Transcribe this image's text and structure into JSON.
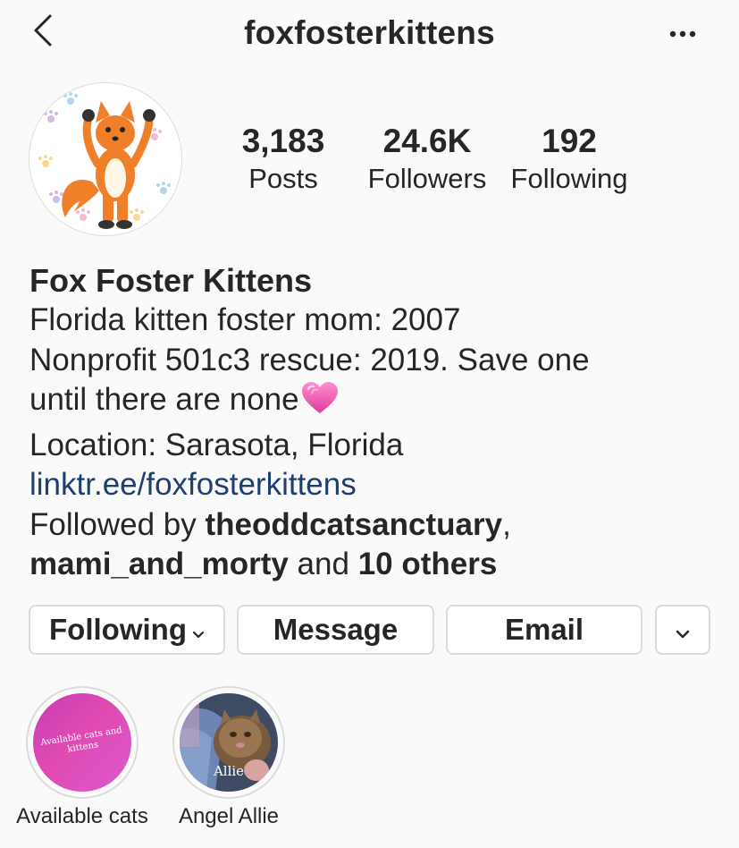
{
  "header": {
    "username": "foxfosterkittens",
    "back_icon": "chevron-left-icon",
    "more_icon": "ellipsis-icon"
  },
  "stats": {
    "posts": {
      "value": "3,183",
      "label": "Posts"
    },
    "followers": {
      "value": "24.6K",
      "label": "Followers"
    },
    "following": {
      "value": "192",
      "label": "Following"
    }
  },
  "bio": {
    "name": "Fox Foster Kittens",
    "line1": "Florida kitten foster mom: 2007",
    "line2": "Nonprofit 501c3 rescue: 2019. Save one",
    "line3": "until there are none",
    "line4": "Location: Sarasota, Florida",
    "link": "linktr.ee/foxfosterkittens",
    "followed_by_prefix": "Followed by ",
    "followed_user1": "theoddcatsanctuary",
    "followed_comma": ",",
    "followed_user2": "mami_and_morty",
    "followed_and": " and ",
    "followed_others": "10 others"
  },
  "actions": {
    "following_label": "Following",
    "message_label": "Message",
    "email_label": "Email"
  },
  "highlights": [
    {
      "label": "Available cats",
      "cover_text": "Available cats and kittens"
    },
    {
      "label": "Angel Allie",
      "cover_text": "Allie"
    }
  ],
  "colors": {
    "background": "#fafafa",
    "text": "#262626",
    "link": "#1f3f6e",
    "border": "#dbdbdb",
    "highlight_gradient_start": "#c93bb7",
    "highlight_gradient_end": "#d95bd0"
  }
}
